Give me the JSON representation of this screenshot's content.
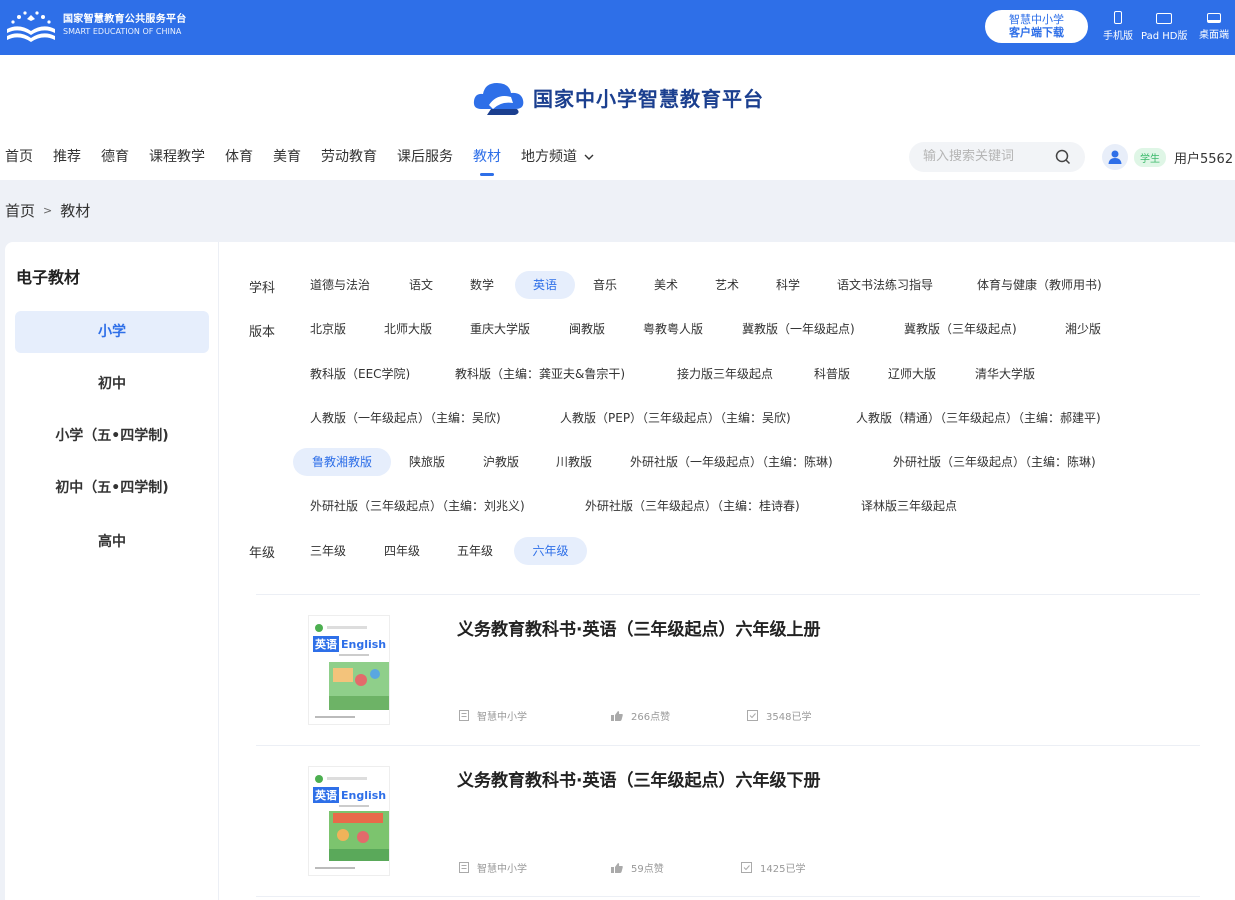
{
  "header": {
    "logo_cn": "国家智慧教育公共服务平台",
    "logo_en": "SMART EDUCATION OF CHINA",
    "client_line1": "智慧中小学",
    "client_line2": "客户端下载",
    "devices": [
      "手机版",
      "Pad HD版",
      "桌面端"
    ]
  },
  "brand": {
    "title": "国家中小学智慧教育平台"
  },
  "nav": {
    "items": [
      "首页",
      "推荐",
      "德育",
      "课程教学",
      "体育",
      "美育",
      "劳动教育",
      "课后服务",
      "教材",
      "地方频道"
    ],
    "active": "教材",
    "search_placeholder": "输入搜索关键词",
    "user_badge": "学生",
    "username": "用户5562"
  },
  "breadcrumb": {
    "home": "首页",
    "sep": ">",
    "current": "教材"
  },
  "sidebar": {
    "title": "电子教材",
    "items": [
      "小学",
      "初中",
      "小学（五•四学制)",
      "初中（五•四学制)",
      "高中"
    ],
    "active": "小学"
  },
  "filters": {
    "subject_label": "学科",
    "subjects": [
      "道德与法治",
      "语文",
      "数学",
      "英语",
      "音乐",
      "美术",
      "艺术",
      "科学",
      "语文书法练习指导",
      "体育与健康（教师用书)"
    ],
    "subject_active": "英语",
    "edition_label": "版本",
    "editions": [
      "北京版",
      "北师大版",
      "重庆大学版",
      "闽教版",
      "粤教粤人版",
      "冀教版（一年级起点)",
      "冀教版（三年级起点)",
      "湘少版",
      "教科版（EEC学院)",
      "教科版（主编：龚亚夫&鲁宗干)",
      "接力版三年级起点",
      "科普版",
      "辽师大版",
      "清华大学版",
      "人教版（一年级起点）（主编：吴欣)",
      "人教版（PEP）（三年级起点）（主编：吴欣)",
      "人教版（精通）（三年级起点）（主编：郝建平)",
      "鲁教湘教版",
      "陕旅版",
      "沪教版",
      "川教版",
      "外研社版（一年级起点）（主编：陈琳)",
      "外研社版（三年级起点）（主编：陈琳)",
      "外研社版（三年级起点）（主编：刘兆义)",
      "外研社版（三年级起点）（主编：桂诗春)",
      "译林版三年级起点"
    ],
    "edition_active": "鲁教湘教版",
    "grade_label": "年级",
    "grades": [
      "三年级",
      "四年级",
      "五年级",
      "六年级"
    ],
    "grade_active": "六年级"
  },
  "books": [
    {
      "title": "义务教育教科书·英语（三年级起点）六年级上册",
      "publisher": "智慧中小学",
      "likes": "266点赞",
      "learned": "3548已学",
      "cover_en": "English",
      "cover_cn": "英语"
    },
    {
      "title": "义务教育教科书·英语（三年级起点）六年级下册",
      "publisher": "智慧中小学",
      "likes": "59点赞",
      "learned": "1425已学",
      "cover_en": "English",
      "cover_cn": "英语"
    }
  ],
  "colors": {
    "primary": "#2e6fe8",
    "brand_dark": "#1b3f8f",
    "student_badge": "#3cb96b"
  }
}
